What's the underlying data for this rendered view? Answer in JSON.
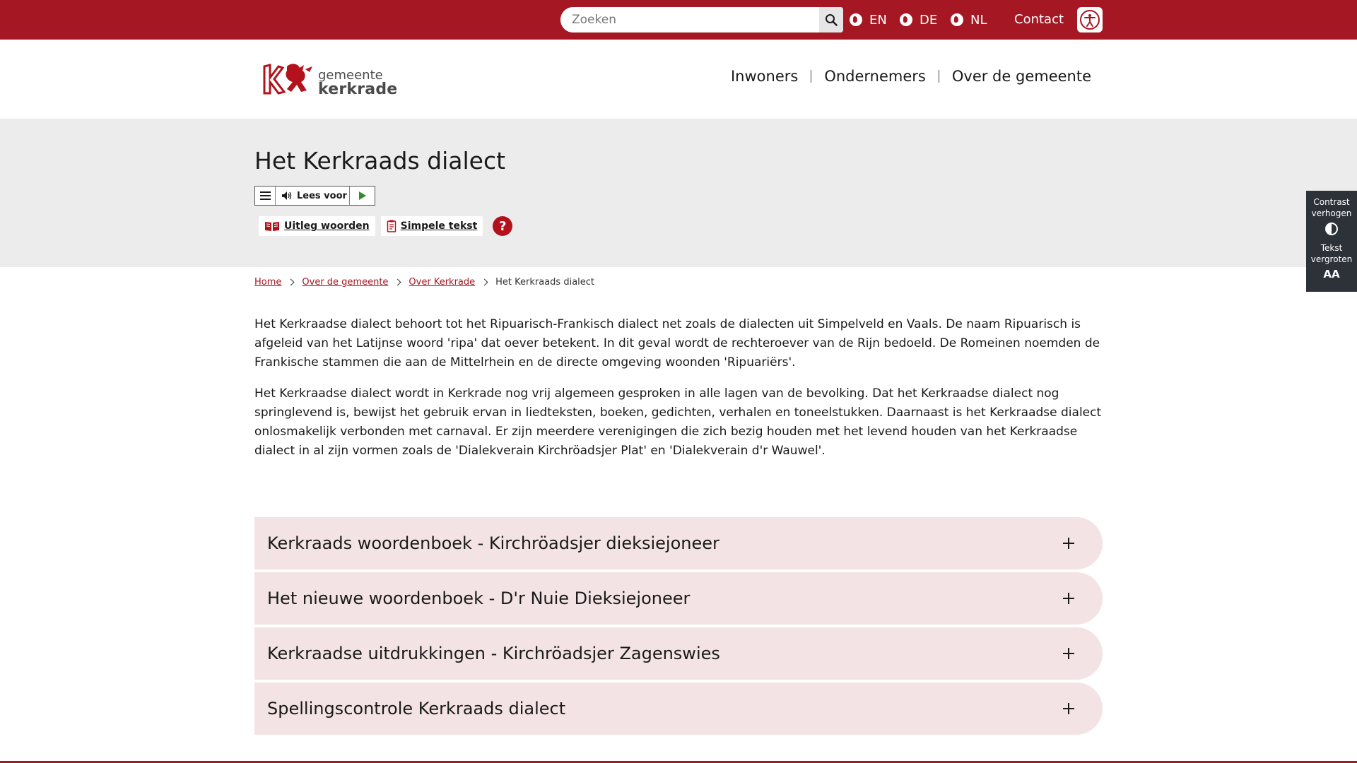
{
  "topbar": {
    "search_placeholder": "Zoeken",
    "languages": [
      "EN",
      "DE",
      "NL"
    ],
    "contact": "Contact"
  },
  "logo": {
    "line1": "gemeente",
    "line2": "kerkrade"
  },
  "nav": {
    "items": [
      "Inwoners",
      "Ondernemers",
      "Over de gemeente"
    ]
  },
  "hero": {
    "title": "Het Kerkraads dialect",
    "read_aloud": "Lees voor",
    "tool_words": "Uitleg woorden",
    "tool_simple": "Simpele tekst",
    "help": "?"
  },
  "sidewidget": {
    "contrast_line1": "Contrast",
    "contrast_line2": "verhogen",
    "text_line1": "Tekst",
    "text_line2": "vergroten",
    "text_icon": "AA"
  },
  "breadcrumb": {
    "home": "Home",
    "level1": "Over de gemeente",
    "level2": "Over Kerkrade",
    "current": "Het Kerkraads dialect"
  },
  "content": {
    "p1": "Het Kerkraadse dialect behoort tot het Ripuarisch-Frankisch dialect net zoals de dialecten uit Simpelveld en Vaals. De naam Ripuarisch is afgeleid van het Latijnse woord 'ripa' dat oever betekent. In dit geval wordt de rechteroever van de Rijn bedoeld. De Romeinen noemden de Frankische stammen die aan de Mittelrhein en de directe omgeving woonden 'Ripuariërs'.",
    "p2": "Het Kerkraadse dialect wordt in Kerkrade nog vrij algemeen gesproken in alle lagen van de bevolking. Dat het Kerkraadse dialect nog springlevend is, bewijst het gebruik ervan in liedteksten, boeken, gedichten, verhalen en toneelstukken. Daarnaast is het Kerkraadse dialect onlosmakelijk verbonden met carnaval. Er zijn meerdere verenigingen die zich bezig houden met het levend houden van het Kerkraadse dialect in al zijn vormen zoals de 'Dialekverain Kirchröadsjer Plat' en 'Dialekverain d'r Wauwel'."
  },
  "accordion": {
    "items": [
      "Kerkraads woordenboek - Kirchröadsjer dieksiejoneer",
      "Het nieuwe woordenboek - D'r Nuie Dieksiejoneer",
      "Kerkraadse uitdrukkingen - Kirchröadsjer Zagenswies",
      "Spellingscontrole Kerkraads dialect"
    ]
  },
  "colors": {
    "brand_red": "#a51722",
    "hero_bg": "#ececec",
    "accordion_bg": "#f4e3e4",
    "widget_bg": "#2d3138"
  },
  "icons": [
    "search-icon",
    "globe-icon",
    "accessibility-icon",
    "menu-icon",
    "speaker-icon",
    "play-icon",
    "book-icon",
    "document-icon",
    "help-icon",
    "contrast-icon",
    "text-size-icon",
    "chevron-right-icon",
    "plus-icon"
  ]
}
